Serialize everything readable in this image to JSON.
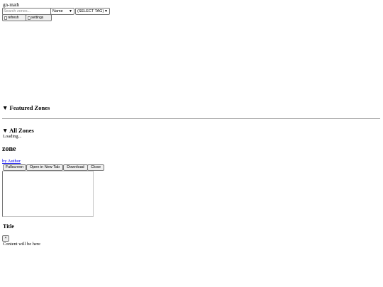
{
  "app": {
    "title": "gn-math"
  },
  "toolbar": {
    "search_placeholder": "Search zones...",
    "sort_selected": "Name",
    "tag_selected": "(SELECT TAG)",
    "refresh_label": "refresh",
    "settings_label": "settings"
  },
  "sections": {
    "featured": "▼ Featured Zones",
    "all": "▼ All Zones",
    "loading": "Loading..."
  },
  "zone_viewer": {
    "title": "zone",
    "author": "by Author",
    "buttons": {
      "fullscreen": "Fullscreen",
      "new_tab": "Open in New Tab",
      "download": "Download",
      "close": "Close"
    }
  },
  "popup": {
    "title": "Title",
    "close_label": "×",
    "body": "Content will be here"
  }
}
